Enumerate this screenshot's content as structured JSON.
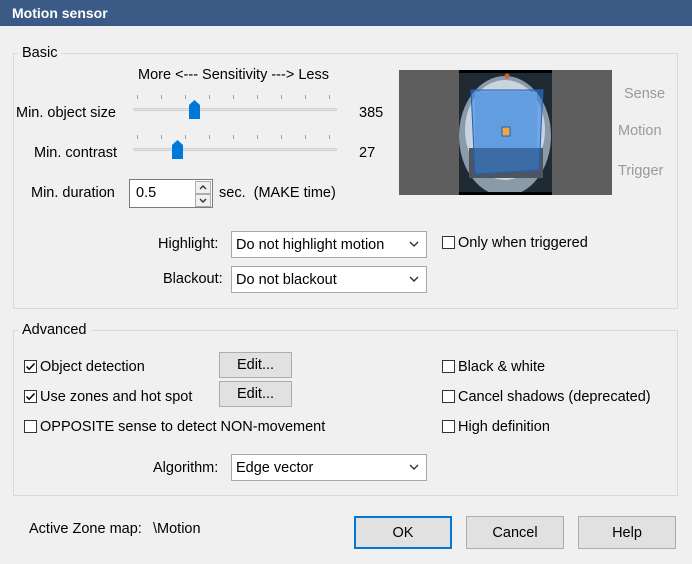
{
  "window": {
    "title": "Motion sensor"
  },
  "basic": {
    "legend": "Basic",
    "sensitivity_caption": "More <--- Sensitivity ---> Less",
    "min_object_size": {
      "label": "Min. object size",
      "value": "385",
      "slider_fraction": 0.29
    },
    "min_contrast": {
      "label": "Min. contrast",
      "value": "27",
      "slider_fraction": 0.2
    },
    "min_duration": {
      "label": "Min. duration",
      "value": "0.5",
      "unit": "sec.  (MAKE time)"
    },
    "highlight": {
      "label": "Highlight:",
      "selected": "Do not highlight motion"
    },
    "only_when_triggered": {
      "label": "Only when triggered",
      "checked": false
    },
    "blackout": {
      "label": "Blackout:",
      "selected": "Do not blackout"
    },
    "indicators": {
      "sense": "Sense",
      "motion": "Motion",
      "trigger": "Trigger"
    }
  },
  "advanced": {
    "legend": "Advanced",
    "object_detection": {
      "label": "Object detection",
      "checked": true,
      "edit_label": "Edit..."
    },
    "use_zones": {
      "label": "Use zones and hot spot",
      "checked": true,
      "edit_label": "Edit..."
    },
    "opposite_sense": {
      "label": "OPPOSITE sense to detect NON-movement",
      "checked": false
    },
    "black_white": {
      "label": "Black & white",
      "checked": false
    },
    "cancel_shadows": {
      "label": "Cancel shadows (deprecated)",
      "checked": false
    },
    "high_definition": {
      "label": "High definition",
      "checked": false
    },
    "algorithm": {
      "label": "Algorithm:",
      "selected": "Edge vector"
    }
  },
  "footer": {
    "active_zone_label": "Active Zone map:",
    "active_zone_value": "\\Motion",
    "ok_label": "OK",
    "cancel_label": "Cancel",
    "help_label": "Help"
  },
  "colors": {
    "title_bar": "#3b5a86",
    "slider_thumb": "#0078d7",
    "preview_overlay": "#2f7fe0"
  }
}
